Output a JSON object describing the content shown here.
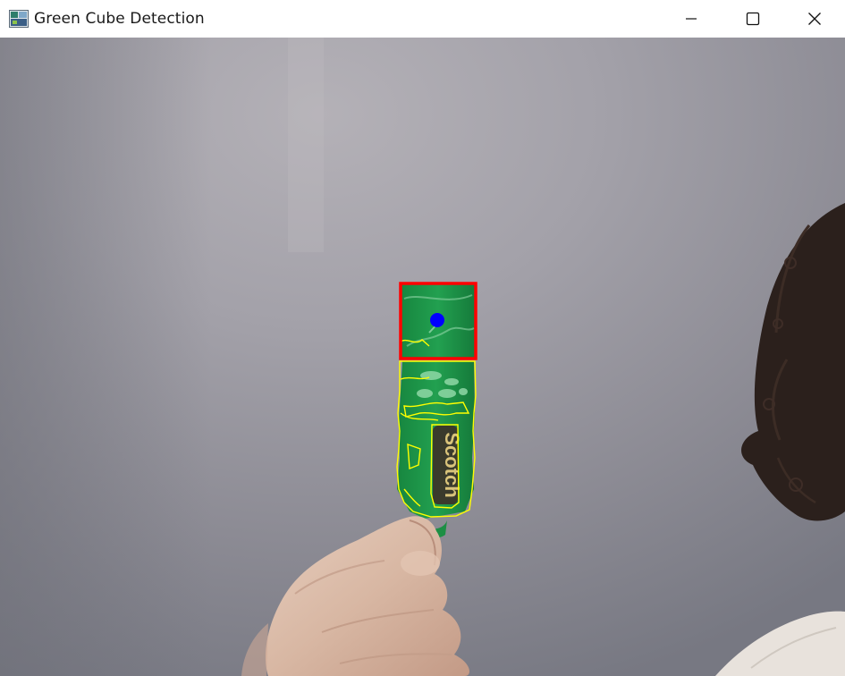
{
  "window": {
    "title": "Green Cube Detection",
    "app_icon": "opencv-window-icon",
    "controls": {
      "minimize_icon": "minimize-icon",
      "maximize_icon": "maximize-icon",
      "close_icon": "close-icon"
    }
  },
  "frame": {
    "scene_text": "Scotch",
    "colors": {
      "bounding_box": "#ff0000",
      "centroid": "#0000ff",
      "contours": "#ffff00",
      "object": "#1e9a4c"
    }
  }
}
